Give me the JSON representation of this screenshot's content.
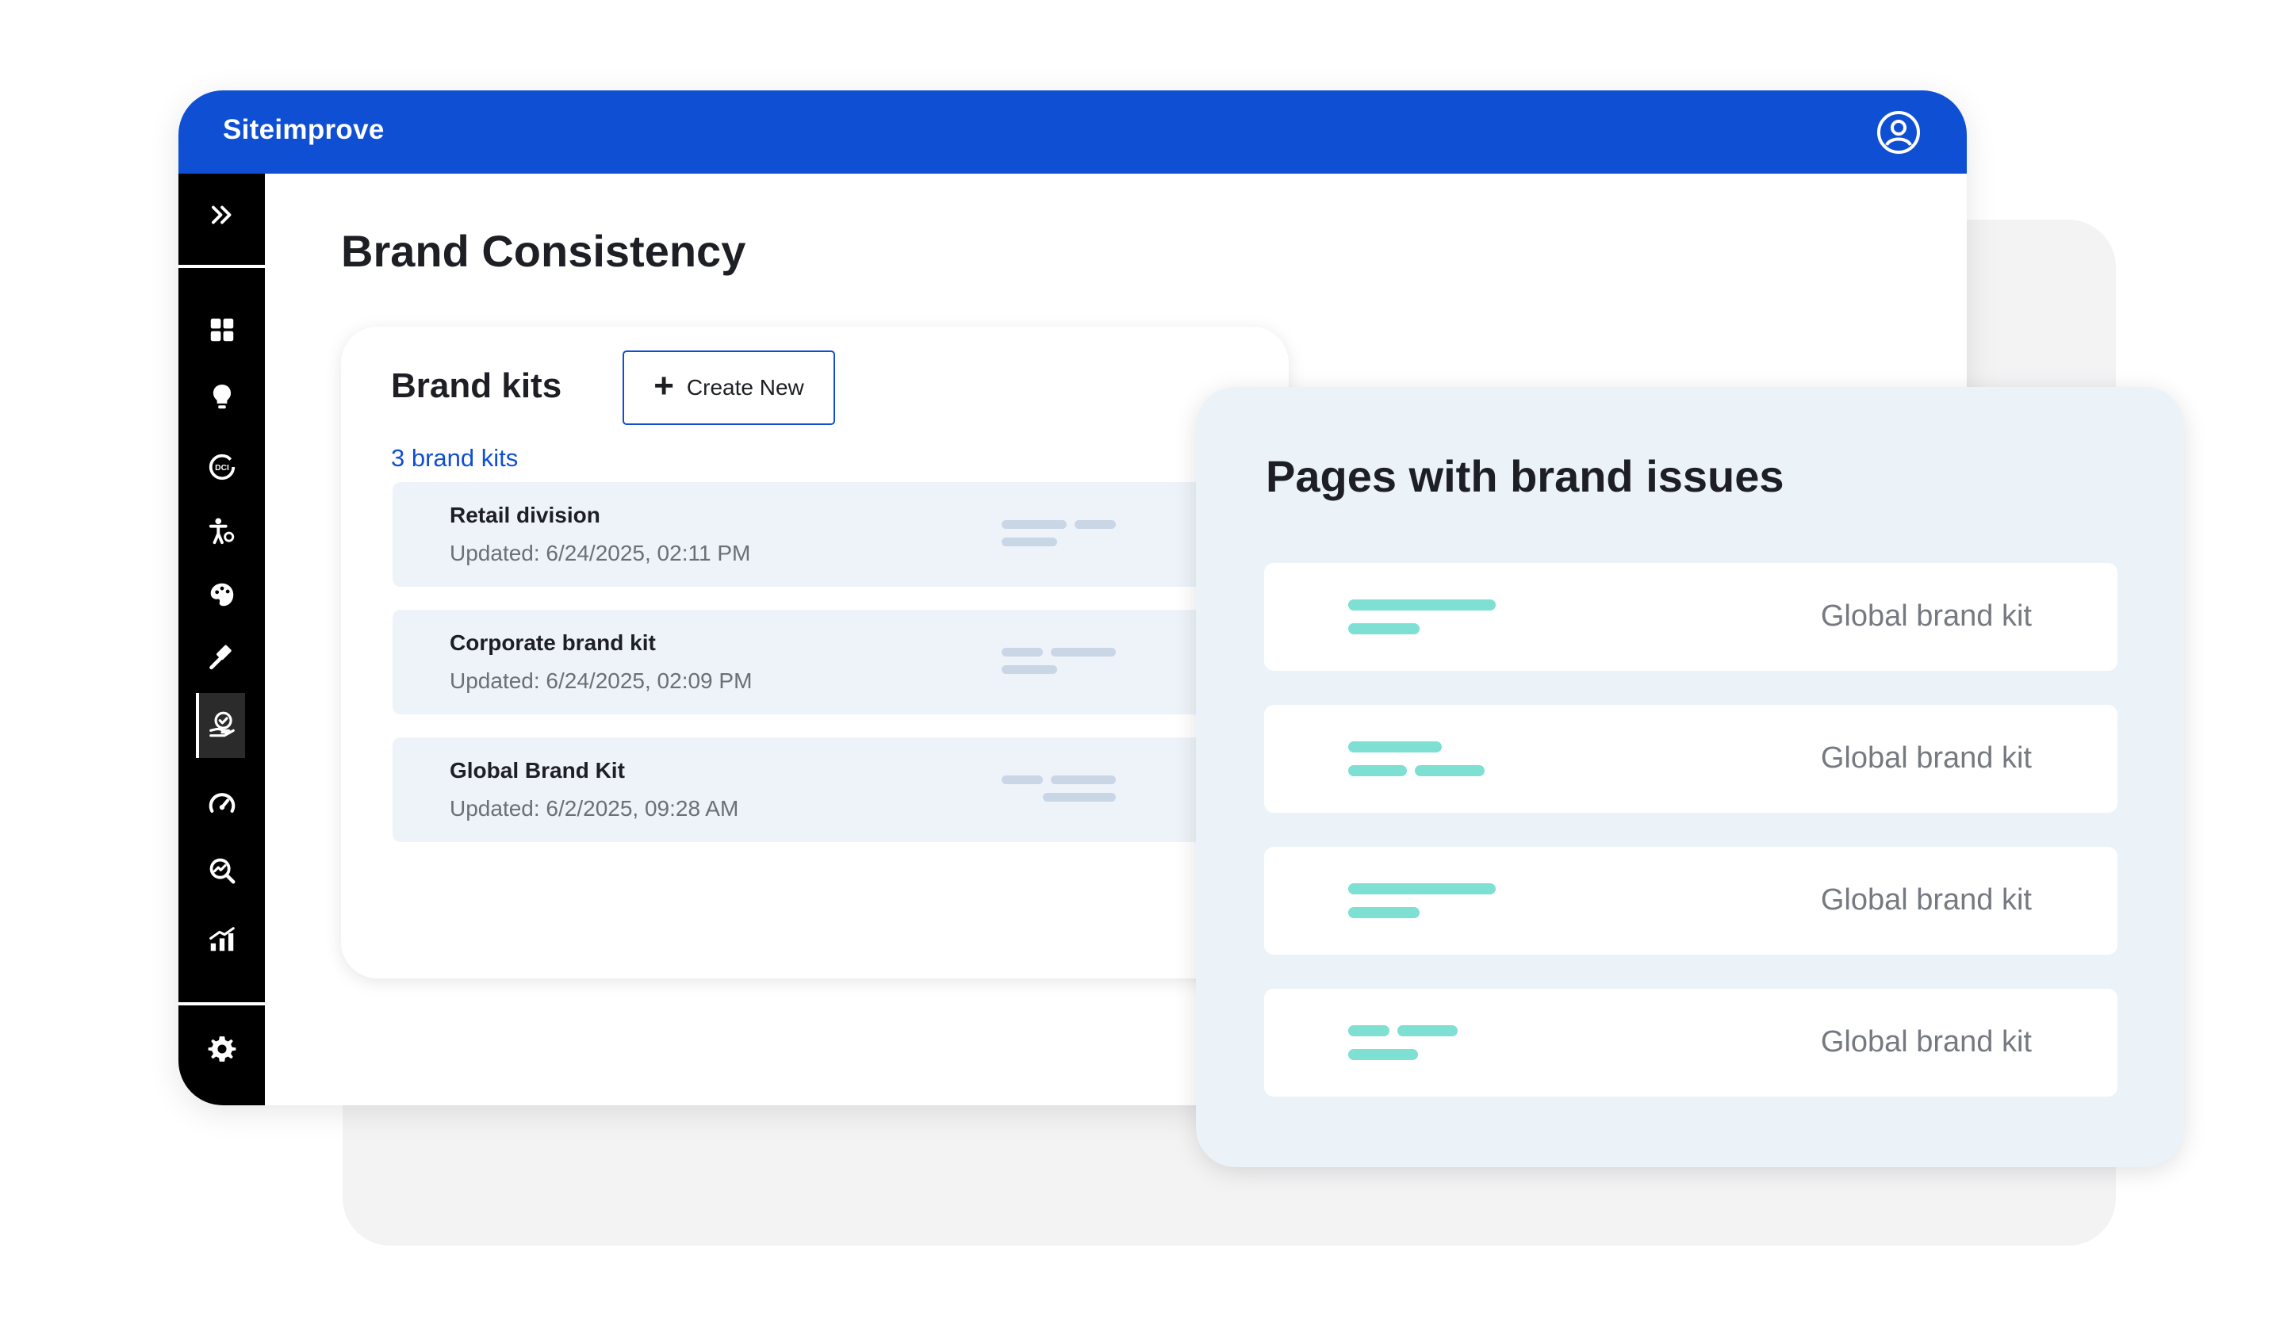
{
  "app": {
    "name": "Siteimprove",
    "accent_color": "#0f4fd3",
    "user_icon": "user-circle-icon"
  },
  "sidebar": {
    "expand_icon": "chevron-double-right-icon",
    "items": [
      {
        "icon": "dashboard-grid-icon"
      },
      {
        "icon": "lightbulb-icon"
      },
      {
        "icon": "dci-score-icon"
      },
      {
        "icon": "accessibility-person-icon"
      },
      {
        "icon": "palette-icon"
      },
      {
        "icon": "gavel-icon"
      },
      {
        "icon": "brand-consistency-icon",
        "active": true
      },
      {
        "icon": "speedometer-icon"
      },
      {
        "icon": "seo-search-icon"
      },
      {
        "icon": "analytics-chart-icon"
      }
    ],
    "settings_icon": "gear-icon"
  },
  "page": {
    "title": "Brand Consistency"
  },
  "brand_kits": {
    "heading": "Brand kits",
    "create_label": "Create New",
    "count_label": "3 brand kits",
    "items": [
      {
        "name": "Retail division",
        "updated": "Updated: 6/24/2025, 02:11 PM"
      },
      {
        "name": "Corporate brand kit",
        "updated": "Updated: 6/24/2025, 02:09 PM"
      },
      {
        "name": "Global Brand Kit",
        "updated": "Updated: 6/2/2025, 09:28 AM"
      }
    ]
  },
  "issues": {
    "title": "Pages with brand issues",
    "skeleton_color": "#7ee0d3",
    "rows": [
      {
        "label": "Global brand kit"
      },
      {
        "label": "Global brand kit"
      },
      {
        "label": "Global brand kit"
      },
      {
        "label": "Global brand kit"
      }
    ]
  }
}
